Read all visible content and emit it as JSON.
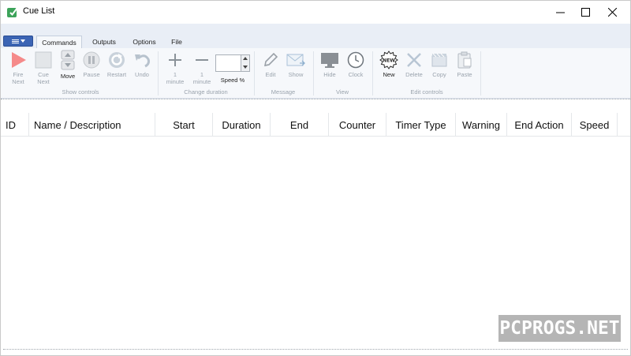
{
  "window": {
    "title": "Cue List"
  },
  "ribbon_tabs": [
    "Commands",
    "Outputs",
    "Options",
    "File"
  ],
  "ribbon": {
    "show_controls": {
      "group_label": "Show controls",
      "fire_next": [
        "Fire",
        "Next"
      ],
      "cue_next": [
        "Cue",
        "Next"
      ],
      "move": "Move",
      "pause": "Pause",
      "restart": "Restart",
      "undo": "Undo"
    },
    "change_duration": {
      "group_label": "Change duration",
      "plus": [
        "1",
        "minute"
      ],
      "minus": [
        "1",
        "minute"
      ],
      "speed_label": "Speed %",
      "speed_value": ""
    },
    "message": {
      "group_label": "Message",
      "edit": "Edit",
      "show": "Show"
    },
    "view": {
      "group_label": "View",
      "hide": "Hide",
      "clock": "Clock"
    },
    "edit_controls": {
      "group_label": "Edit controls",
      "new": "New",
      "new_badge": "NEW",
      "delete": "Delete",
      "copy": "Copy",
      "paste": "Paste"
    }
  },
  "grid": {
    "columns": [
      "ID",
      "Name / Description",
      "Start",
      "Duration",
      "End",
      "Counter",
      "Timer Type",
      "Warning",
      "End Action",
      "Speed"
    ],
    "rows": []
  },
  "watermark": "PCPROGS.NET",
  "colors": {
    "accent": "#3b64b4",
    "fire": "#f27b7b",
    "disabled": "#9aa3ad"
  },
  "icons": [
    "app-logo-icon",
    "minimize-icon",
    "maximize-icon",
    "close-icon",
    "menu-icon",
    "play-icon",
    "cue-square-icon",
    "move-updown-icon",
    "pause-icon",
    "restart-icon",
    "undo-icon",
    "plus-icon",
    "minus-icon",
    "pencil-icon",
    "envelope-icon",
    "monitor-icon",
    "clock-icon",
    "new-badge-icon",
    "delete-x-icon",
    "copy-icon",
    "paste-icon"
  ]
}
